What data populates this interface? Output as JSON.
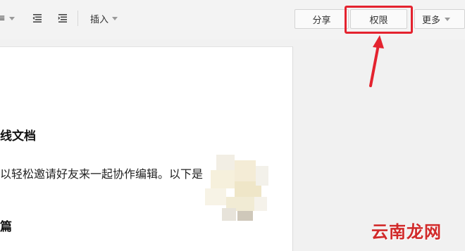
{
  "toolbar": {
    "insert_label": "插入",
    "share_label": "分享",
    "permission_label": "权限",
    "more_label": "更多"
  },
  "document": {
    "heading_fragment": "线文档",
    "body_fragment": "以轻松邀请好友来一起协作编辑。以下是",
    "sub_fragment": "篇"
  },
  "annotation": {
    "highlight_color": "#e4232f"
  },
  "watermark": "云南龙网"
}
